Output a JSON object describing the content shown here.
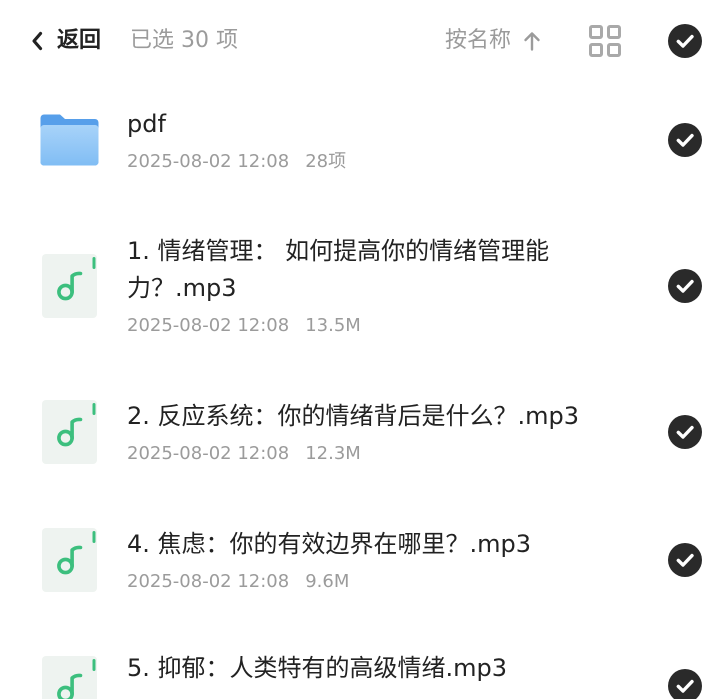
{
  "header": {
    "back_icon": "chevron-left-icon",
    "back_label": "返回",
    "selected_text": "已选 30 项",
    "sort_label": "按名称",
    "sort_icon": "arrow-up-icon",
    "view_icon": "grid-icon",
    "select_all_icon": "check-circle-icon",
    "select_all_checked": true
  },
  "files": [
    {
      "icon": "folder-icon",
      "name": "pdf",
      "date": "2025-08-02 12:08",
      "info": "28项",
      "selected": true
    },
    {
      "icon": "music-file-icon",
      "name": "1. 情绪管理： 如何提高你的情绪管理能力？.mp3",
      "date": "2025-08-02 12:08",
      "info": "13.5M",
      "selected": true
    },
    {
      "icon": "music-file-icon",
      "name": "2. 反应系统：你的情绪背后是什么？.mp3",
      "date": "2025-08-02 12:08",
      "info": "12.3M",
      "selected": true
    },
    {
      "icon": "music-file-icon",
      "name": "4. 焦虑：你的有效边界在哪里？.mp3",
      "date": "2025-08-02 12:08",
      "info": "9.6M",
      "selected": true
    },
    {
      "icon": "music-file-icon",
      "name": "5. 抑郁：人类特有的高级情绪.mp3",
      "selected": true
    }
  ],
  "colors": {
    "text_primary": "#222222",
    "text_secondary": "#9b9b9b",
    "icon_gray": "#a9a9a9",
    "check_fill": "#2a2a2a",
    "check_mark": "#ffffff",
    "folder_tab": "#579fea",
    "folder_front_top": "#a8d3f9",
    "folder_front_bottom": "#80bdf4",
    "audio_green": "#3cbf7e",
    "audio_bg": "#eef3f0"
  }
}
